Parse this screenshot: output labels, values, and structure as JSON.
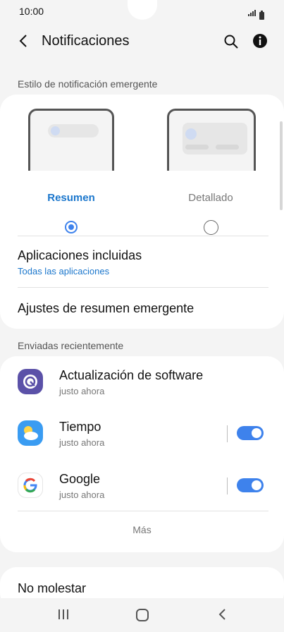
{
  "status": {
    "time": "10:00"
  },
  "header": {
    "title": "Notificaciones"
  },
  "section1": {
    "label": "Estilo de notificación emergente"
  },
  "style_options": [
    {
      "label": "Resumen",
      "selected": true
    },
    {
      "label": "Detallado",
      "selected": false
    }
  ],
  "included_apps": {
    "title": "Aplicaciones incluidas",
    "subtitle": "Todas las aplicaciones"
  },
  "summary_settings": {
    "title": "Ajustes de resumen emergente"
  },
  "section2": {
    "label": "Enviadas recientemente"
  },
  "recent_apps": [
    {
      "name": "Actualización de software",
      "time": "justo ahora",
      "icon": "software-update-icon",
      "toggle": null
    },
    {
      "name": "Tiempo",
      "time": "justo ahora",
      "icon": "weather-icon",
      "toggle": true
    },
    {
      "name": "Google",
      "time": "justo ahora",
      "icon": "google-icon",
      "toggle": true
    }
  ],
  "more": {
    "label": "Más"
  },
  "do_not_disturb": {
    "title": "No molestar"
  },
  "colors": {
    "accent": "#3e82ec",
    "link": "#1a76cc",
    "background": "#f4f4f4"
  }
}
